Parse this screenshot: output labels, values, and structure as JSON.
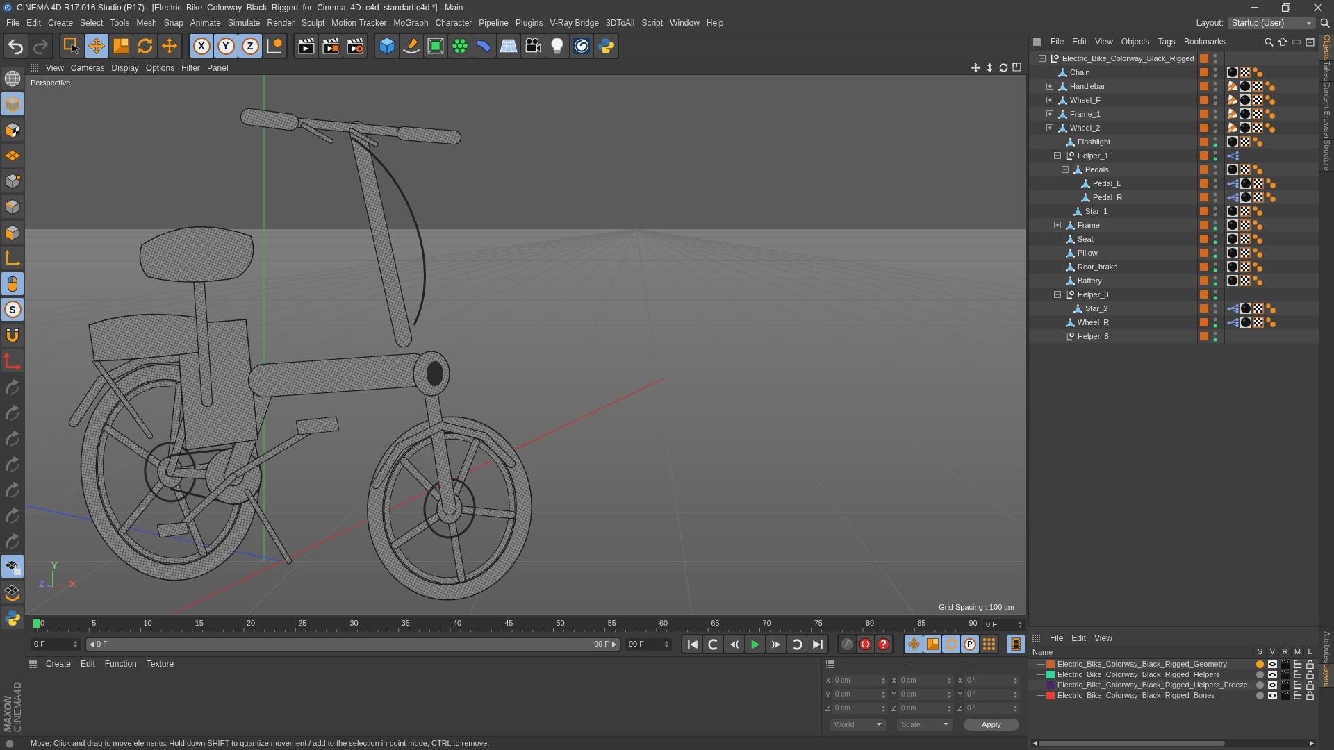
{
  "window": {
    "title": "CINEMA 4D R17.016 Studio (R17) - [Electric_Bike_Colorway_Black_Rigged_for_Cinema_4D_c4d_standart.c4d *] - Main"
  },
  "menu": [
    "File",
    "Edit",
    "Create",
    "Select",
    "Tools",
    "Mesh",
    "Snap",
    "Animate",
    "Simulate",
    "Render",
    "Sculpt",
    "Motion Tracker",
    "MoGraph",
    "Character",
    "Pipeline",
    "Plugins",
    "V-Ray Bridge",
    "3DToAll",
    "Script",
    "Window",
    "Help"
  ],
  "layout": {
    "label": "Layout:",
    "value": "Startup (User)"
  },
  "toolbar": [
    [
      {
        "kind": "undo",
        "disabled": false
      },
      {
        "kind": "redo",
        "disabled": true
      }
    ],
    [
      {
        "kind": "select",
        "selected": false
      },
      {
        "kind": "move",
        "selected": true
      },
      {
        "kind": "scale",
        "selected": false
      },
      {
        "kind": "rotate",
        "selected": false
      },
      {
        "kind": "transform",
        "selected": false
      }
    ],
    [
      {
        "kind": "axis",
        "label": "X",
        "selected": true
      },
      {
        "kind": "axis",
        "label": "Y",
        "selected": true
      },
      {
        "kind": "axis",
        "label": "Z",
        "selected": true
      },
      {
        "kind": "coords",
        "selected": false
      }
    ],
    [
      {
        "kind": "render-view"
      },
      {
        "kind": "render-picture"
      },
      {
        "kind": "render-settings"
      }
    ],
    [
      {
        "kind": "cube"
      },
      {
        "kind": "pen"
      },
      {
        "kind": "subdivide"
      },
      {
        "kind": "cloner"
      },
      {
        "kind": "bend"
      },
      {
        "kind": "floor"
      },
      {
        "kind": "camera"
      },
      {
        "kind": "light"
      },
      {
        "kind": "swirl"
      },
      {
        "kind": "python"
      }
    ]
  ],
  "left_toolbar": [
    {
      "kind": "globe",
      "selected": false,
      "disabled": false
    },
    {
      "kind": "model-mode",
      "selected": true,
      "disabled": false
    },
    {
      "kind": "texture-mode",
      "selected": false,
      "disabled": false
    },
    {
      "kind": "workplane",
      "selected": false,
      "disabled": false
    },
    {
      "kind": "points-mode",
      "selected": false,
      "disabled": false
    },
    {
      "kind": "edges-mode",
      "selected": false,
      "disabled": false
    },
    {
      "kind": "polygons-mode",
      "selected": false,
      "disabled": false
    },
    {
      "kind": "axis-mode",
      "selected": false,
      "disabled": false
    },
    {
      "kind": "tweak",
      "selected": true,
      "disabled": false
    },
    {
      "kind": "snap",
      "label": "S",
      "selected": true,
      "disabled": false
    },
    {
      "kind": "magnet",
      "selected": false,
      "disabled": false
    },
    {
      "kind": "axes",
      "selected": false,
      "disabled": false
    },
    {
      "kind": "key-move",
      "selected": false,
      "disabled": true
    },
    {
      "kind": "key-pos",
      "selected": false,
      "disabled": true
    },
    {
      "kind": "key-rot",
      "selected": false,
      "disabled": true
    },
    {
      "kind": "key-psr",
      "selected": false,
      "disabled": true
    },
    {
      "kind": "key-param",
      "selected": false,
      "disabled": true
    },
    {
      "kind": "key-pla",
      "selected": false,
      "disabled": true
    },
    {
      "kind": "key-point",
      "selected": false,
      "disabled": true
    },
    {
      "kind": "grid-lock",
      "selected": true,
      "disabled": false
    },
    {
      "kind": "grid-rotate",
      "selected": false,
      "disabled": false
    },
    {
      "kind": "python",
      "selected": false,
      "disabled": false
    }
  ],
  "logo": {
    "brand": "MAXON",
    "product": "CINEMA**4D**"
  },
  "viewport": {
    "menu": [
      "View",
      "Cameras",
      "Display",
      "Options",
      "Filter",
      "Panel"
    ],
    "camera": "Perspective",
    "grid_spacing": "Grid Spacing : 100 cm",
    "gizmo": [
      {
        "label": "Y",
        "color": "#6fd86f"
      },
      {
        "label": "Z",
        "color": "#6a86e8"
      },
      {
        "label": "X",
        "color": "#e85a5a"
      }
    ]
  },
  "timeline": {
    "ticks": [
      "0",
      "5",
      "10",
      "15",
      "20",
      "25",
      "30",
      "35",
      "40",
      "45",
      "50",
      "55",
      "60",
      "65",
      "70",
      "75",
      "80",
      "85",
      "90"
    ],
    "level": 0,
    "frame": "0 F"
  },
  "transport": {
    "start": "0 F",
    "range": {
      "level": 1,
      "start": "0 F",
      "end": "90 F"
    },
    "end": "90 F",
    "playback": [
      {
        "kind": "first"
      },
      {
        "kind": "prev-key"
      },
      {
        "kind": "prev"
      },
      {
        "kind": "play"
      },
      {
        "kind": "next"
      },
      {
        "kind": "next-key"
      },
      {
        "kind": "last"
      }
    ],
    "record": [
      {
        "kind": "key",
        "disabled": true
      },
      {
        "kind": "record",
        "disabled": false
      },
      {
        "kind": "autokey",
        "disabled": false
      }
    ],
    "key_tracks": [
      {
        "kind": "move",
        "selected": true
      },
      {
        "kind": "scale",
        "selected": true
      },
      {
        "kind": "rotate",
        "selected": true
      },
      {
        "kind": "param",
        "label": "P",
        "selected": true
      },
      {
        "kind": "dots",
        "selected": false
      }
    ],
    "timeline_view": {
      "kind": "film",
      "on": true
    }
  },
  "materials": {
    "menu": [
      "Create",
      "Edit",
      "Function",
      "Texture"
    ]
  },
  "coordinates": {
    "headers": [
      "--",
      "--",
      "--"
    ],
    "rows": [
      {
        "cells": [
          {
            "axis": "X",
            "value": "0 cm"
          },
          {
            "axis": "X",
            "value": "0 cm"
          },
          {
            "axis": "X",
            "value": "0 °"
          }
        ]
      },
      {
        "cells": [
          {
            "axis": "Y",
            "value": "0 cm"
          },
          {
            "axis": "Y",
            "value": "0 cm"
          },
          {
            "axis": "Y",
            "value": "0 °"
          }
        ]
      },
      {
        "cells": [
          {
            "axis": "Z",
            "value": "0 cm"
          },
          {
            "axis": "Z",
            "value": "0 cm"
          },
          {
            "axis": "Z",
            "value": "0 °"
          }
        ]
      }
    ],
    "modes": [
      "World",
      "Scale"
    ],
    "apply": "Apply"
  },
  "status_bar": "Move: Click and drag to move elements. Hold down SHIFT to quantize movement / add to the selection in point mode, CTRL to remove.",
  "objects": {
    "menu": [
      "File",
      "Edit",
      "View",
      "Objects",
      "Tags",
      "Bookmarks"
    ],
    "tree": [
      {
        "name": "Electric_Bike_Colorway_Black_Rigged",
        "kind": "null",
        "expanded": true,
        "render_on": false,
        "children": [
          {
            "name": "Chain",
            "kind": "polygon",
            "render_on": false,
            "tags": [
              {
                "kind": "material"
              },
              {
                "kind": "texture"
              },
              {
                "kind": "phong"
              }
            ]
          },
          {
            "name": "Handlebar",
            "kind": "polygon",
            "expanded": false,
            "render_on": false,
            "tags": [
              {
                "kind": "weight"
              },
              {
                "kind": "material"
              },
              {
                "kind": "texture"
              },
              {
                "kind": "phong"
              }
            ]
          },
          {
            "name": "Wheel_F",
            "kind": "polygon",
            "expanded": false,
            "render_on": false,
            "tags": [
              {
                "kind": "weight"
              },
              {
                "kind": "material"
              },
              {
                "kind": "texture"
              },
              {
                "kind": "phong"
              }
            ]
          },
          {
            "name": "Frame_1",
            "kind": "polygon",
            "expanded": false,
            "render_on": false,
            "tags": [
              {
                "kind": "weight"
              },
              {
                "kind": "material"
              },
              {
                "kind": "texture"
              },
              {
                "kind": "phong"
              }
            ]
          },
          {
            "name": "Wheel_2",
            "kind": "polygon",
            "expanded": false,
            "render_on": false,
            "tags": [
              {
                "kind": "weight"
              },
              {
                "kind": "material"
              },
              {
                "kind": "texture"
              },
              {
                "kind": "phong"
              }
            ],
            "children": [
              {
                "name": "Flashlight",
                "kind": "polygon",
                "render_on": true,
                "tags": [
                  {
                    "kind": "material"
                  },
                  {
                    "kind": "texture"
                  },
                  {
                    "kind": "phong"
                  }
                ]
              },
              {
                "name": "Helper_1",
                "kind": "null",
                "expanded": true,
                "render_on": true,
                "tags": [
                  {
                    "kind": "skin"
                  }
                ],
                "children": [
                  {
                    "name": "Pedals",
                    "kind": "polygon",
                    "expanded": true,
                    "render_on": false,
                    "tags": [
                      {
                        "kind": "material"
                      },
                      {
                        "kind": "texture"
                      },
                      {
                        "kind": "phong"
                      }
                    ],
                    "children": [
                      {
                        "name": "Pedal_L",
                        "kind": "polygon",
                        "render_on": false,
                        "tags": [
                          {
                            "kind": "skin"
                          },
                          {
                            "kind": "material"
                          },
                          {
                            "kind": "texture"
                          },
                          {
                            "kind": "phong"
                          }
                        ]
                      },
                      {
                        "name": "Pedal_R",
                        "kind": "polygon",
                        "render_on": false,
                        "tags": [
                          {
                            "kind": "skin"
                          },
                          {
                            "kind": "material"
                          },
                          {
                            "kind": "texture"
                          },
                          {
                            "kind": "phong"
                          }
                        ]
                      }
                    ]
                  },
                  {
                    "name": "Star_1",
                    "kind": "polygon",
                    "render_on": false,
                    "tags": [
                      {
                        "kind": "material"
                      },
                      {
                        "kind": "texture"
                      },
                      {
                        "kind": "phong"
                      }
                    ]
                  }
                ]
              },
              {
                "name": "Frame",
                "kind": "polygon",
                "expanded": false,
                "render_on": true,
                "tags": [
                  {
                    "kind": "material"
                  },
                  {
                    "kind": "texture"
                  },
                  {
                    "kind": "phong"
                  }
                ]
              },
              {
                "name": "Seat",
                "kind": "polygon",
                "render_on": true,
                "tags": [
                  {
                    "kind": "material"
                  },
                  {
                    "kind": "texture"
                  },
                  {
                    "kind": "phong"
                  }
                ]
              },
              {
                "name": "Pillow",
                "kind": "polygon",
                "render_on": true,
                "tags": [
                  {
                    "kind": "material"
                  },
                  {
                    "kind": "texture"
                  },
                  {
                    "kind": "phong"
                  }
                ]
              },
              {
                "name": "Rear_brake",
                "kind": "polygon",
                "render_on": true,
                "tags": [
                  {
                    "kind": "material"
                  },
                  {
                    "kind": "texture"
                  },
                  {
                    "kind": "phong"
                  }
                ]
              },
              {
                "name": "Battery",
                "kind": "polygon",
                "render_on": true,
                "tags": [
                  {
                    "kind": "material"
                  },
                  {
                    "kind": "texture"
                  },
                  {
                    "kind": "phong"
                  }
                ]
              },
              {
                "name": "Helper_3",
                "kind": "null",
                "expanded": true,
                "render_on": true,
                "children": [
                  {
                    "name": "Star_2",
                    "kind": "polygon",
                    "render_on": false,
                    "tags": [
                      {
                        "kind": "skin"
                      },
                      {
                        "kind": "material"
                      },
                      {
                        "kind": "texture"
                      },
                      {
                        "kind": "phong"
                      }
                    ]
                  }
                ]
              },
              {
                "name": "Wheel_R",
                "kind": "polygon",
                "render_on": true,
                "tags": [
                  {
                    "kind": "skin"
                  },
                  {
                    "kind": "material"
                  },
                  {
                    "kind": "texture"
                  },
                  {
                    "kind": "phong"
                  }
                ]
              },
              {
                "name": "Helper_8",
                "kind": "null",
                "render_on": true
              }
            ]
          }
        ]
      }
    ]
  },
  "right_tabs": [
    {
      "label": "Objects",
      "selected": true
    },
    {
      "label": "Takes",
      "selected": false
    },
    {
      "label": "Content Browser",
      "selected": false
    },
    {
      "label": "Structure",
      "selected": false
    }
  ],
  "layers": {
    "menu": [
      "File",
      "Edit",
      "View"
    ],
    "columns": [
      "Name",
      "S",
      "V",
      "R",
      "M",
      "L"
    ],
    "rows": [
      {
        "name": "Electric_Bike_Colorway_Black_Rigged_Geometry",
        "color": "#c8622c",
        "solo": true
      },
      {
        "name": "Electric_Bike_Colorway_Black_Rigged_Helpers",
        "color": "#2fd79b",
        "solo": false
      },
      {
        "name": "Electric_Bike_Colorway_Black_Rigged_Helpers_Freeze",
        "color": "#4a2766",
        "solo": false
      },
      {
        "name": "Electric_Bike_Colorway_Black_Rigged_Bones",
        "color": "#e8413d",
        "solo": false
      }
    ]
  },
  "bottom_tabs": [
    {
      "label": "Attributes",
      "selected": false
    },
    {
      "label": "Layers",
      "selected": true
    }
  ]
}
